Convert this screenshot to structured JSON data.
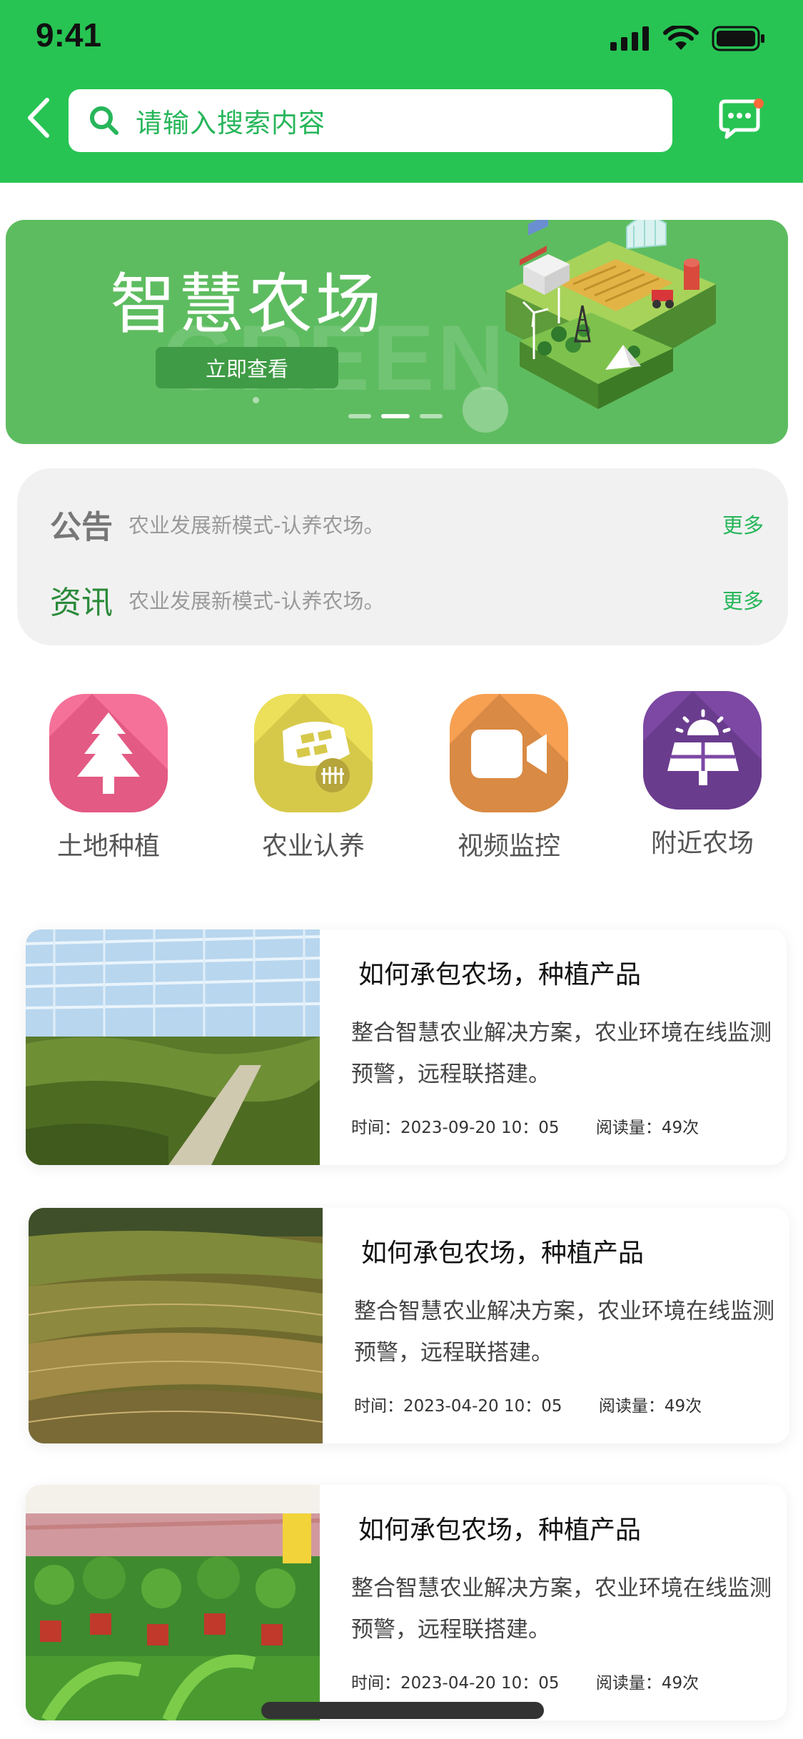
{
  "status_bar": {
    "time": "9:41"
  },
  "search": {
    "placeholder": "请输入搜索内容"
  },
  "banner": {
    "title": "智慧农场",
    "watermark": "GREEN",
    "button_label": "立即查看",
    "page_count": 3,
    "active_page": 2
  },
  "notices": [
    {
      "tag": "公告",
      "text": "农业发展新模式-认养农场。",
      "more": "更多"
    },
    {
      "tag": "资讯",
      "text": "农业发展新模式-认养农场。",
      "more": "更多"
    }
  ],
  "features": [
    {
      "label": "土地种植",
      "icon": "tree-icon",
      "color": "#f5719a"
    },
    {
      "label": "农业认养",
      "icon": "field-fence-icon",
      "color": "#ecdf5a"
    },
    {
      "label": "视频监控",
      "icon": "video-camera-icon",
      "color": "#f7a052"
    },
    {
      "label": "附近农场",
      "icon": "solar-panel-icon",
      "color": "#7c48a4"
    }
  ],
  "articles": [
    {
      "title": "如何承包农场，种植产品",
      "desc": "整合智慧农业解决方案，农业环境在线监测预警，远程联搭建。",
      "time": "时间：2023-09-20  10：05",
      "views": "阅读量：49次",
      "image": "greenhouse-photo"
    },
    {
      "title": "如何承包农场，种植产品",
      "desc": "整合智慧农业解决方案，农业环境在线监测预警，远程联搭建。",
      "time": "时间：2023-04-20  10：05",
      "views": "阅读量：49次",
      "image": "terraces-photo"
    },
    {
      "title": "如何承包农场，种植产品",
      "desc": "整合智慧农业解决方案，农业环境在线监测预警，远程联搭建。",
      "time": "时间：2023-04-20  10：05",
      "views": "阅读量：49次",
      "image": "potted-plants-photo"
    }
  ],
  "colors": {
    "brand_green": "#27c453",
    "banner_green": "#5ebc60",
    "link_green": "#27b65a",
    "notice_bg": "#f1f1f1"
  }
}
